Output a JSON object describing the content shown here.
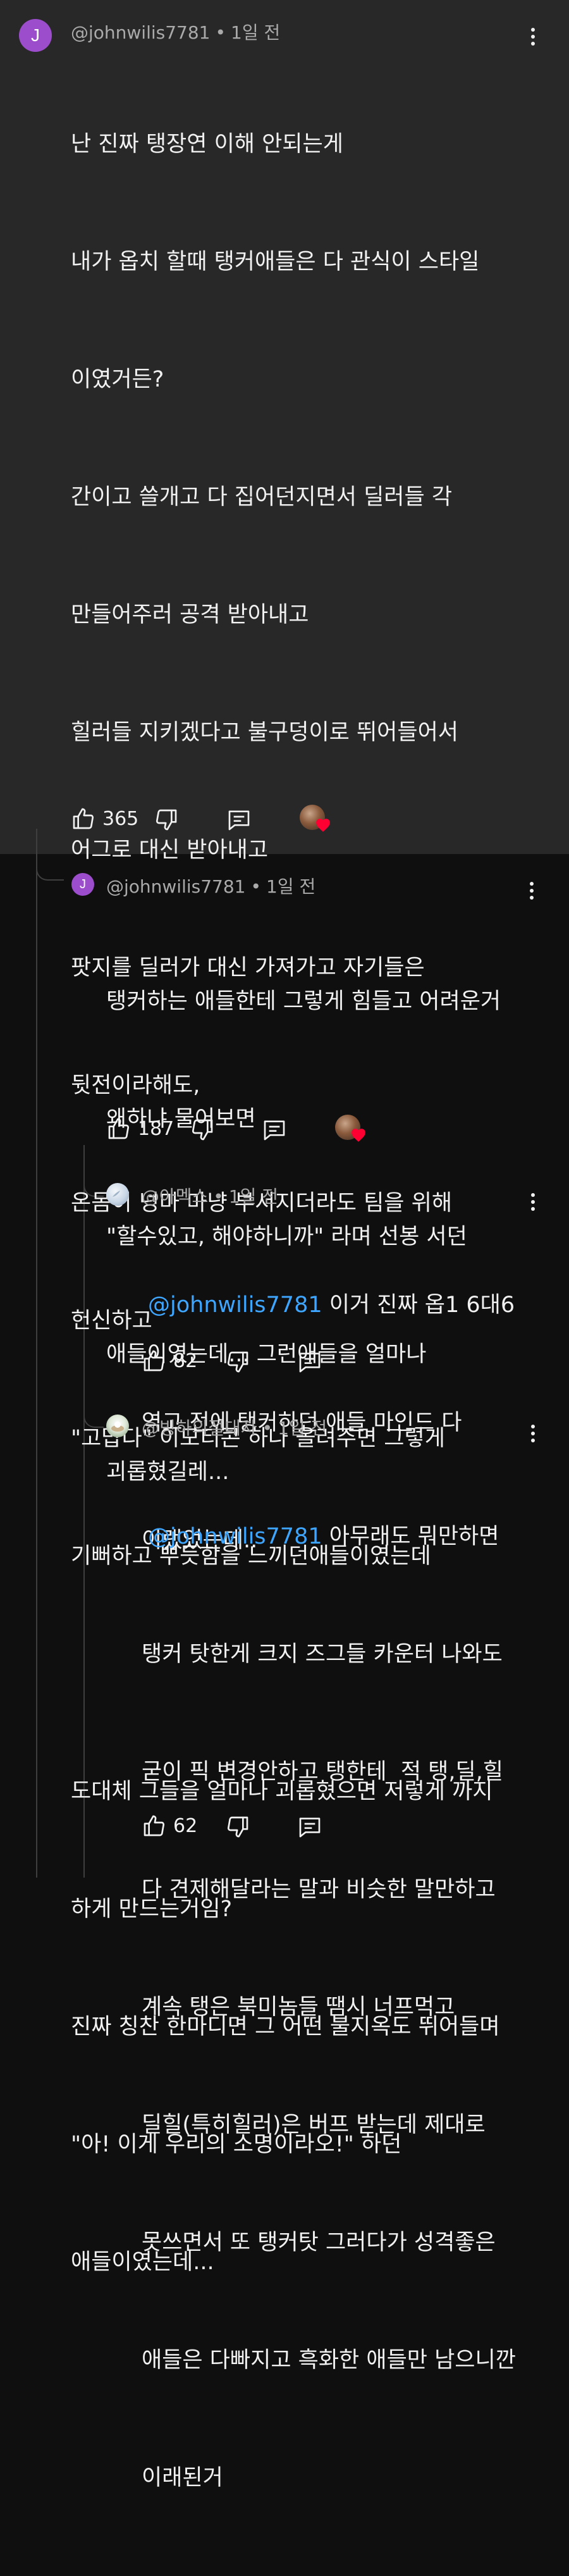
{
  "comments": [
    {
      "author": "@johnwilis7781",
      "time": "1일 전",
      "avatar_letter": "J",
      "lines": [
        "난 진짜 탱장연 이해 안되는게",
        "내가 옵치 할때 탱커애들은 다 관식이 스타일",
        "이였거든?",
        "간이고 쓸개고 다 집어던지면서 딜러들 각",
        "만들어주러 공격 받아내고",
        "힐러들 지키겠다고 불구덩이로 뛰어들어서",
        "어그로 대신 받아내고",
        "팟지를 딜러가 대신 가져가고 자기들은",
        "뒷전이라해도,",
        "온몸이 넝마 마냥 부서지더라도 팀을 위해",
        "헌신하고",
        "\"고맙다\" 이모티콘 하나 올려주면 그렇게",
        "기뻐하고 뿌듯함을 느끼던애들이였는데",
        "",
        "도대체 그들을 얼마나 괴롭혔으면 저렇게 까지",
        "하게 만드는거임?",
        "진짜 칭찬 한마디면 그 어떤 불지옥도 뛰어들며",
        "\"아! 이게 우리의 소명이라오!\" 하던",
        "애들이였는데..."
      ],
      "likes": "365"
    },
    {
      "author": "@johnwilis7781",
      "time": "1일 전",
      "avatar_letter": "J",
      "lines": [
        "탱커하는 애들한테 그렇게 힘들고 어려운거",
        "왜하냐 물어보면",
        "\"할수있고, 해야하니까\" 라며 선봉 서던",
        "애들이였는데... 그런애들을 얼마나",
        "괴롭혔길레..."
      ],
      "likes": "187"
    },
    {
      "author": "@아멕스",
      "time": "1일 전",
      "mention": "@johnwilis7781",
      "lines": [
        " 이거 진짜 옵1 6대6",
        "역고 전에 탱커하던 애들 마인드 다",
        "이랬었는데.."
      ],
      "likes": "82"
    },
    {
      "author": "@빙하의절대자",
      "time": "1일 전",
      "mention": "@johnwilis7781",
      "lines": [
        " 아무래도 뭐만하면",
        "탱커 탓한게 크지 즈그들 카운터 나와도",
        "굳이 픽 변경안하고 탱한테  적 탱,딜,힐",
        "다 견제해달라는 말과 비슷한 말만하고",
        "계속 탱은 북미놈들 땜시 너프먹고",
        "딜힐(특히힐러)은 버프 받는데 제대로",
        "못쓰면서 또 탱커탓 그러다가 성격좋은",
        "애들은 다빠지고 흑화한 애들만 남으니깐",
        "이래된거"
      ],
      "likes": "62"
    }
  ],
  "icons": {
    "like": "thumbs-up-icon",
    "dislike": "thumbs-down-icon",
    "reply": "reply-icon",
    "more": "more-vert-icon",
    "creator_heart": "creator-heart-icon"
  },
  "colors": {
    "highlight_bg": "#282828",
    "page_bg": "#0f0f0f",
    "avatar_purple": "#9c4dcc",
    "mention_blue": "#3ea6ff",
    "heart_red": "#ff0033"
  }
}
